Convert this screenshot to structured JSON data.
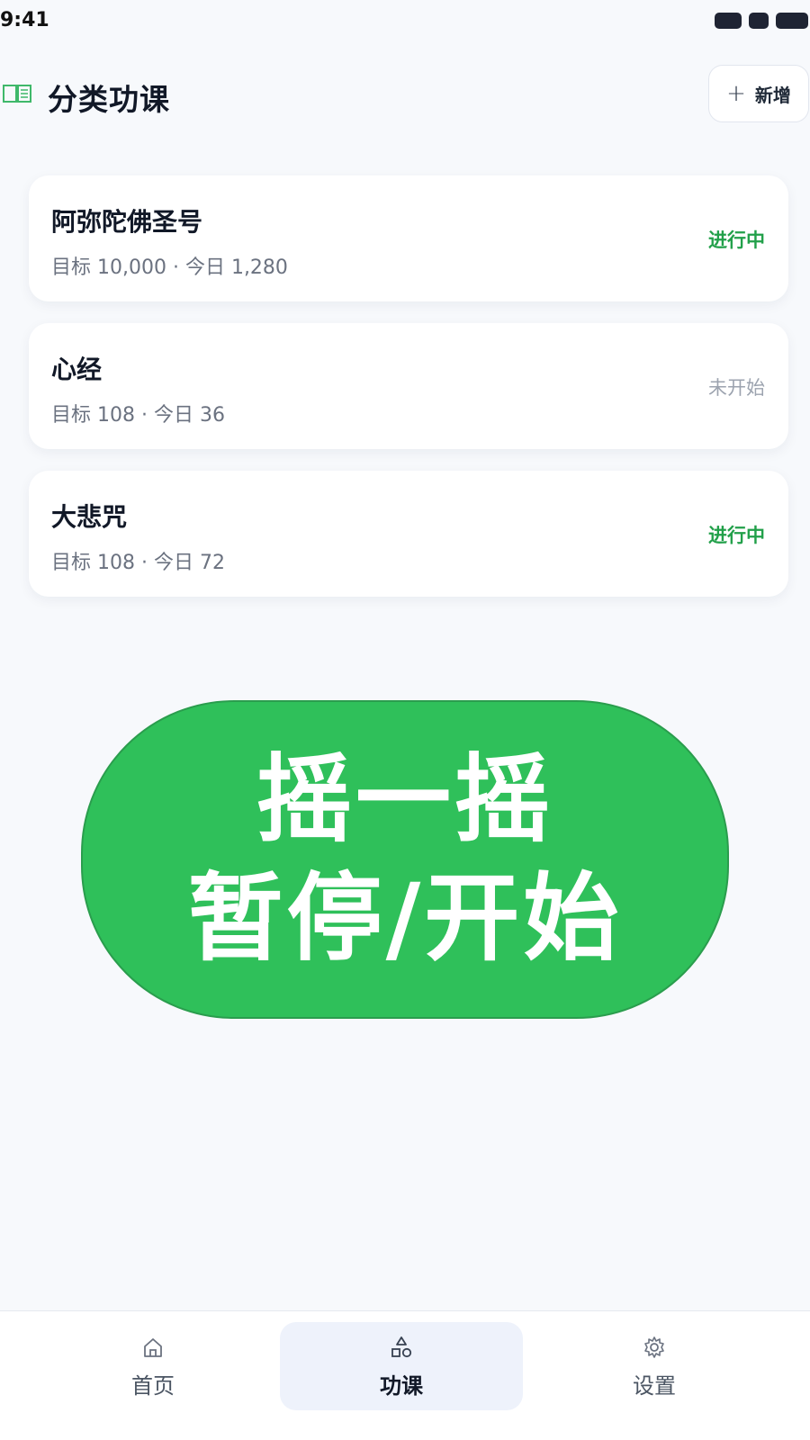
{
  "status_bar": {
    "time": "9:41"
  },
  "header": {
    "title": "分类功课",
    "add_label": "新增",
    "add_icon": "plus-icon",
    "title_icon": "book-icon"
  },
  "lessons": [
    {
      "name": "阿弥陀佛圣号",
      "meta": "目标 10,000 · 今日 1,280",
      "status": "进行中",
      "status_type": "active"
    },
    {
      "name": "心经",
      "meta": "目标 108 · 今日 36",
      "status": "未开始",
      "status_type": "idle"
    },
    {
      "name": "大悲咒",
      "meta": "目标 108 · 今日 72",
      "status": "进行中",
      "status_type": "active"
    }
  ],
  "overlay": {
    "line1": "摇一摇",
    "line2": "暂停/开始"
  },
  "tab_bar": {
    "tabs": [
      {
        "label": "首页",
        "icon": "home-icon"
      },
      {
        "label": "功课",
        "icon": "shapes-icon",
        "active": true
      },
      {
        "label": "设置",
        "icon": "gear-icon"
      }
    ]
  },
  "colors": {
    "accent": "#2fc05a",
    "status_active": "#22a04a",
    "status_idle": "#9ca3af",
    "background": "#f7f9fc"
  }
}
